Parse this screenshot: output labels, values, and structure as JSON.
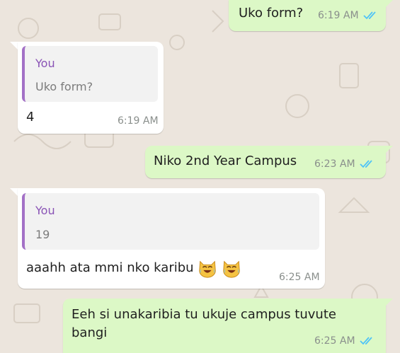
{
  "colors": {
    "background": "#ece5dd",
    "outgoing_bubble": "#dcf8c6",
    "incoming_bubble": "#ffffff",
    "read_ticks": "#4fc3f7",
    "quote_accent": "#a370c6",
    "quote_author": "#8a54b6"
  },
  "messages": [
    {
      "direction": "outgoing",
      "text": "Uko form?",
      "time": "6:19 AM",
      "status": "read-double-check-icon"
    },
    {
      "direction": "incoming",
      "quote": {
        "author": "You",
        "text": "Uko form?"
      },
      "text": "4",
      "time": "6:19 AM"
    },
    {
      "direction": "outgoing",
      "text": "Niko 2nd Year Campus",
      "time": "6:23 AM",
      "status": "read-double-check-icon"
    },
    {
      "direction": "incoming",
      "quote": {
        "author": "You",
        "text": "19"
      },
      "text": "aaahh ata mmi nko karibu",
      "emoji": "cat-tears-of-joy-emoji",
      "time": "6:25 AM"
    },
    {
      "direction": "outgoing",
      "text": "Eeh si unakaribia tu ukuje campus tuvute bangi",
      "time": "6:25 AM",
      "status": "read-double-check-icon"
    }
  ]
}
